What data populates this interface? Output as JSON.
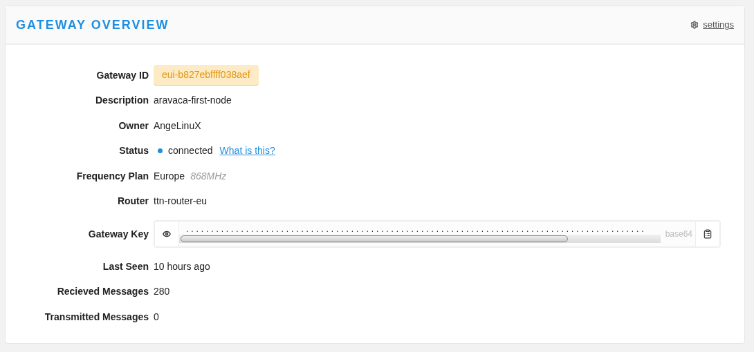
{
  "panel": {
    "title": "GATEWAY OVERVIEW",
    "settings_link": "settings"
  },
  "fields": [
    {
      "kind": "badge",
      "label": "Gateway ID",
      "value": "eui-b827ebffff038aef"
    },
    {
      "kind": "text",
      "label": "Description",
      "value": "aravaca-first-node"
    },
    {
      "kind": "text",
      "label": "Owner",
      "value": "AngeLinuX"
    },
    {
      "kind": "status",
      "label": "Status",
      "value": "connected",
      "color": "#1e8fe0",
      "link": "What is this?"
    },
    {
      "kind": "text_note",
      "label": "Frequency Plan",
      "value": "Europe",
      "note": "868MHz"
    },
    {
      "kind": "text",
      "label": "Router",
      "value": "ttn-router-eu"
    },
    {
      "kind": "secret",
      "label": "Gateway Key",
      "value": "............................................................................................",
      "format": "base64"
    },
    {
      "kind": "text",
      "label": "Last Seen",
      "value": "10 hours ago"
    },
    {
      "kind": "text",
      "label": "Recieved Messages",
      "value": "280"
    },
    {
      "kind": "text",
      "label": "Transmitted Messages",
      "value": "0"
    }
  ]
}
